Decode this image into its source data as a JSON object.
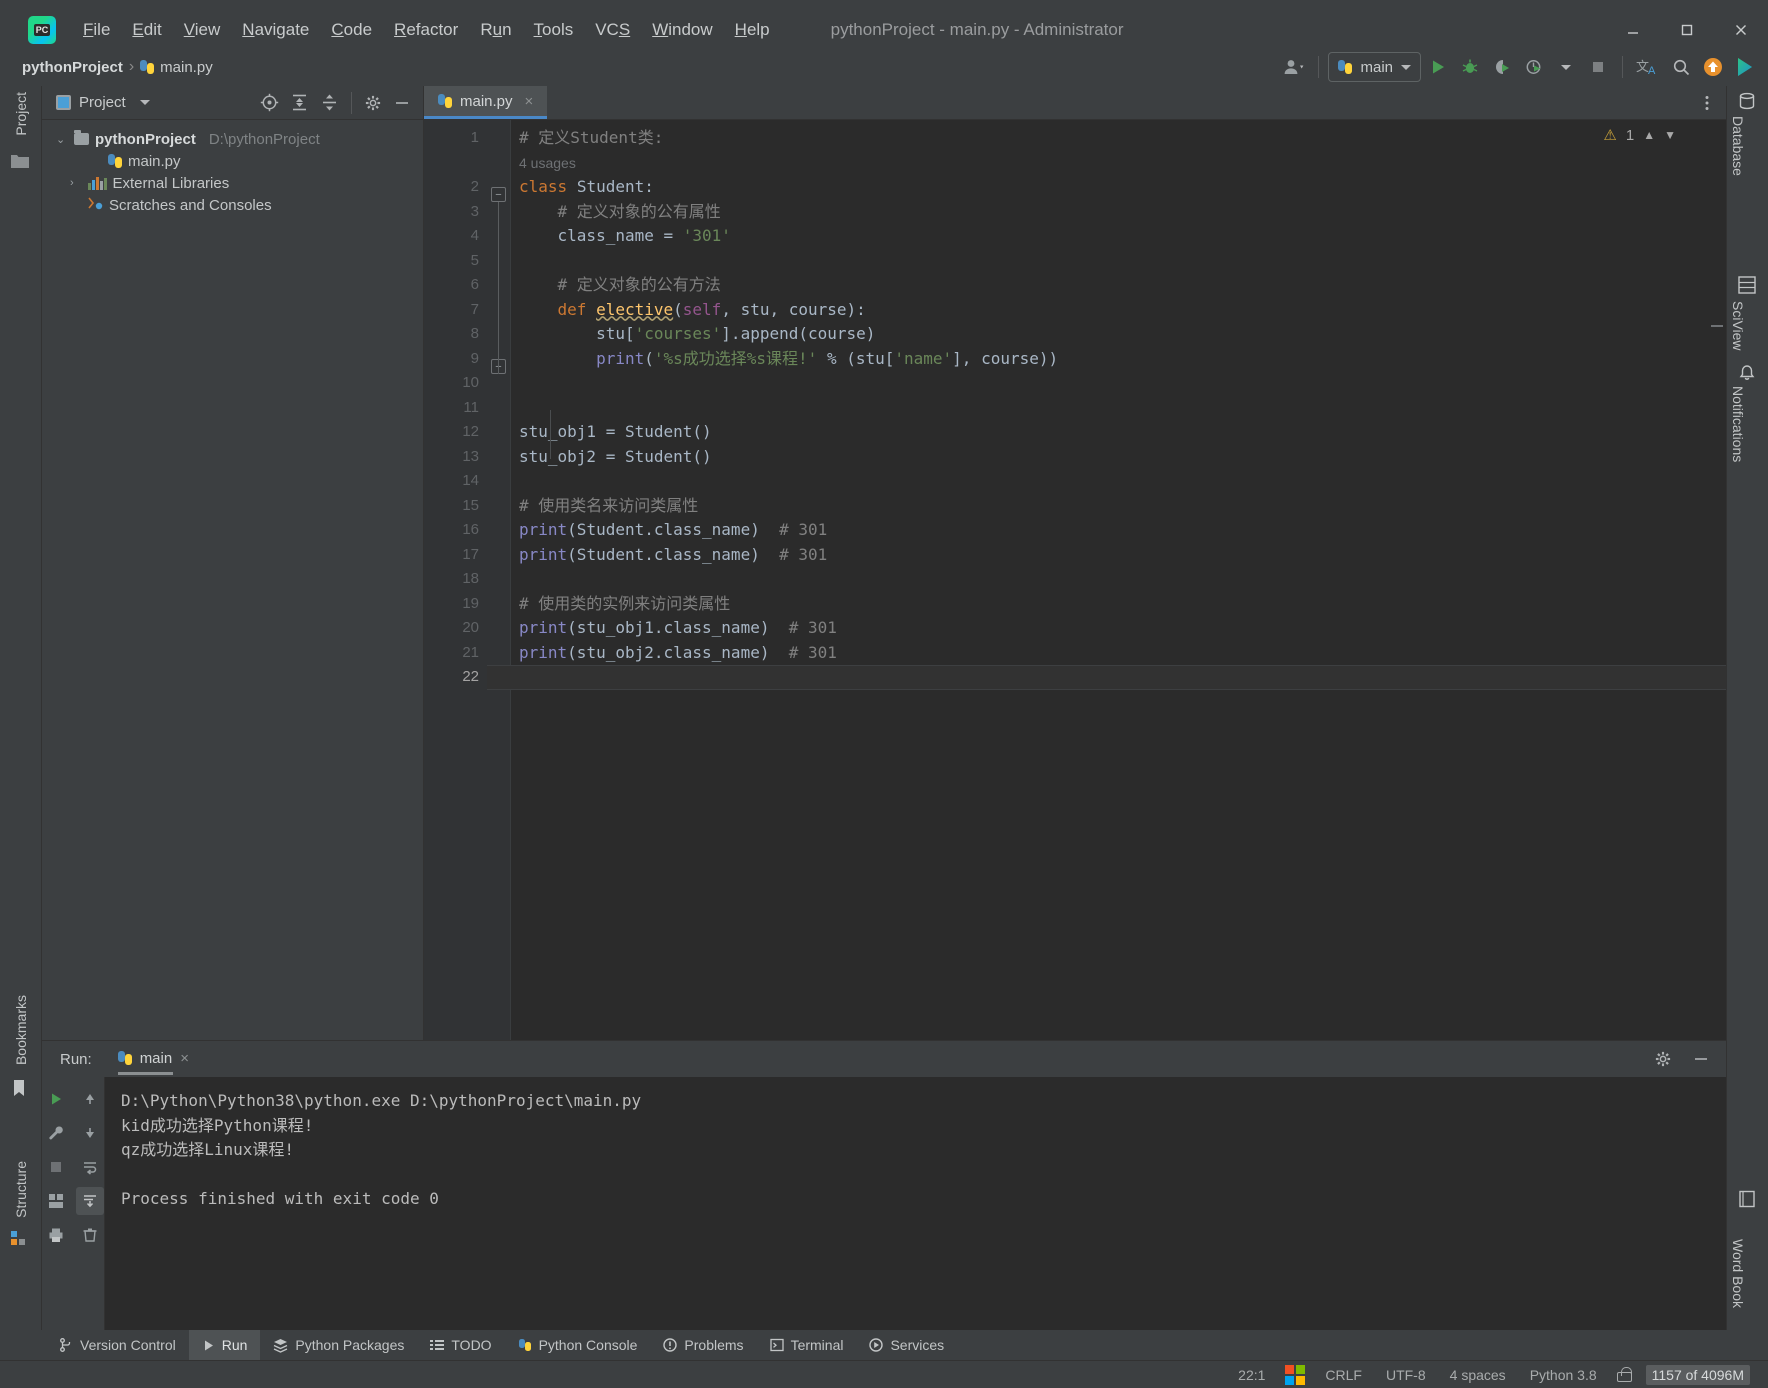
{
  "window": {
    "title": "pythonProject - main.py - Administrator",
    "minimize_label": "Minimize",
    "maximize_label": "Maximize",
    "close_label": "Close"
  },
  "menubar": [
    {
      "label": "File",
      "mnemonic": "F"
    },
    {
      "label": "Edit",
      "mnemonic": "E"
    },
    {
      "label": "View",
      "mnemonic": "V"
    },
    {
      "label": "Navigate",
      "mnemonic": "N"
    },
    {
      "label": "Code",
      "mnemonic": "C"
    },
    {
      "label": "Refactor",
      "mnemonic": "R"
    },
    {
      "label": "Run",
      "mnemonic": "u"
    },
    {
      "label": "Tools",
      "mnemonic": "T"
    },
    {
      "label": "VCS",
      "mnemonic": "S"
    },
    {
      "label": "Window",
      "mnemonic": "W"
    },
    {
      "label": "Help",
      "mnemonic": "H"
    }
  ],
  "breadcrumb": {
    "project": "pythonProject",
    "file": "main.py"
  },
  "toolbar": {
    "run_config": "main",
    "run_label": "Run",
    "debug_label": "Debug",
    "coverage_label": "Run with Coverage",
    "profile_label": "Profile",
    "stop_label": "Stop",
    "translate_label": "Translate",
    "search_everywhere_label": "Search Everywhere",
    "updates_label": "Updates",
    "ide_eval_label": "IDE Feature Trainer"
  },
  "project_panel": {
    "title": "Project",
    "tools": {
      "locate_label": "Select Opened File",
      "expand_label": "Expand All",
      "collapse_label": "Collapse All",
      "settings_label": "Options",
      "hide_label": "Hide"
    },
    "tree": [
      {
        "label": "pythonProject",
        "path": "D:\\pythonProject",
        "level": 0,
        "arrow": "⌄",
        "icon": "folder-icon"
      },
      {
        "label": "main.py",
        "path": "",
        "level": 2,
        "arrow": "",
        "icon": "python-file-icon"
      },
      {
        "label": "External Libraries",
        "path": "",
        "level": 1,
        "arrow": "›",
        "icon": "library-icon"
      },
      {
        "label": "Scratches and Consoles",
        "path": "",
        "level": 1,
        "arrow": "",
        "icon": "scratches-icon"
      }
    ]
  },
  "left_strip": {
    "project": "Project",
    "bookmarks": "Bookmarks",
    "structure": "Structure"
  },
  "right_strip": {
    "database": "Database",
    "sciview": "SciView",
    "notifications": "Notifications",
    "word_book": "Word Book"
  },
  "editor": {
    "tab": "main.py",
    "tab_close": "×",
    "usages_hint": "4 usages",
    "inspection_count": "1",
    "current_line": 22,
    "lines": [
      {
        "n": 1,
        "html": "<span class='c-com'># 定义Student类:</span>"
      },
      {
        "n": 2,
        "html": "<span class='c-kw'>class</span> <span class='c-def'>Student</span>:"
      },
      {
        "n": 3,
        "html": "    <span class='c-com'># 定义对象的公有属性</span>"
      },
      {
        "n": 4,
        "html": "    class_name = <span class='c-str'>'301'</span>"
      },
      {
        "n": 5,
        "html": ""
      },
      {
        "n": 6,
        "html": "    <span class='c-com'># 定义对象的公有方法</span>"
      },
      {
        "n": 7,
        "html": "    <span class='c-kw'>def</span> <span class='c-fn squig'>elective</span>(<span class='c-self'>self</span>, stu, course):"
      },
      {
        "n": 8,
        "html": "        stu[<span class='c-str'>'courses'</span>].append(course)"
      },
      {
        "n": 9,
        "html": "        <span class='c-bi'>print</span>(<span class='c-str'>'%s成功选择%s课程!'</span> % (stu[<span class='c-str'>'name'</span>], course))"
      },
      {
        "n": 10,
        "html": ""
      },
      {
        "n": 11,
        "html": ""
      },
      {
        "n": 12,
        "html": "stu_obj1 = Student()"
      },
      {
        "n": 13,
        "html": "stu_obj2 = Student()"
      },
      {
        "n": 14,
        "html": ""
      },
      {
        "n": 15,
        "html": "<span class='c-com'># 使用类名来访问类属性</span>"
      },
      {
        "n": 16,
        "html": "<span class='c-bi'>print</span>(Student.class_name)  <span class='c-com'># 301</span>"
      },
      {
        "n": 17,
        "html": "<span class='c-bi'>print</span>(Student.class_name)  <span class='c-com'># 301</span>"
      },
      {
        "n": 18,
        "html": ""
      },
      {
        "n": 19,
        "html": "<span class='c-com'># 使用类的实例来访问类属性</span>"
      },
      {
        "n": 20,
        "html": "<span class='c-bi'>print</span>(stu_obj1.class_name)  <span class='c-com'># 301</span>"
      },
      {
        "n": 21,
        "html": "<span class='c-bi'>print</span>(stu_obj2.class_name)  <span class='c-com'># 301</span>"
      },
      {
        "n": 22,
        "html": ""
      }
    ]
  },
  "run_panel": {
    "label": "Run:",
    "tab": "main",
    "tab_close": "×",
    "settings_label": "Settings",
    "hide_label": "Hide",
    "side_buttons": {
      "rerun": "Rerun",
      "up": "Up the stack trace",
      "down": "Down the stack trace",
      "soft_wrap": "Soft-Wrap",
      "scroll_end": "Scroll to the end",
      "stop": "Stop",
      "layout": "Layout",
      "print": "Print",
      "clear": "Clear All"
    },
    "console": [
      "D:\\Python\\Python38\\python.exe D:\\pythonProject\\main.py",
      "kid成功选择Python课程!",
      "qz成功选择Linux课程!",
      "",
      "Process finished with exit code 0"
    ]
  },
  "bottom_tabs": [
    {
      "label": "Version Control",
      "icon": "branch-icon",
      "active": false
    },
    {
      "label": "Run",
      "icon": "play-icon",
      "active": true
    },
    {
      "label": "Python Packages",
      "icon": "packages-icon",
      "active": false
    },
    {
      "label": "TODO",
      "icon": "todo-icon",
      "active": false
    },
    {
      "label": "Python Console",
      "icon": "python-icon",
      "active": false
    },
    {
      "label": "Problems",
      "icon": "problems-icon",
      "active": false
    },
    {
      "label": "Terminal",
      "icon": "terminal-icon",
      "active": false
    },
    {
      "label": "Services",
      "icon": "services-icon",
      "active": false
    }
  ],
  "statusbar": {
    "caret": "22:1",
    "line_separator": "CRLF",
    "encoding": "UTF-8",
    "indent": "4 spaces",
    "interpreter": "Python 3.8",
    "memory": "1157 of 4096M",
    "lock_label": "Toggle read-only attribute"
  },
  "colors": {
    "accent": "#4a88c7",
    "panel": "#3c3f41",
    "editor_bg": "#2b2b2b",
    "gutter": "#313335",
    "green": "#499c54",
    "string": "#6a8759",
    "keyword": "#cc7832",
    "comment": "#808080",
    "builtin": "#8888c6",
    "function": "#ffc66d",
    "self": "#94558d"
  }
}
